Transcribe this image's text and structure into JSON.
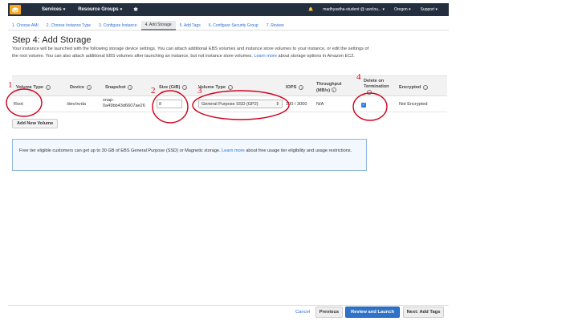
{
  "nav": {
    "services": "Services",
    "resource_groups": "Resource Groups",
    "user": "madhyastha-student @ uwclou...",
    "region": "Oregon",
    "support": "Support"
  },
  "steps": [
    "1. Choose AMI",
    "2. Choose Instance Type",
    "3. Configure Instance",
    "4. Add Storage",
    "5. Add Tags",
    "6. Configure Security Group",
    "7. Review"
  ],
  "page": {
    "title": "Step 4: Add Storage",
    "desc_1": "Your instance will be launched with the following storage device settings. You can attach additional EBS volumes and instance store volumes to your instance, or edit the settings of the root volume. You can also attach additional EBS volumes after launching an instance, but not instance store volumes. ",
    "desc_link": "Learn more",
    "desc_2": " about storage options in Amazon EC2."
  },
  "table": {
    "headers": {
      "volume_type": "Volume Type",
      "device": "Device",
      "snapshot": "Snapshot",
      "size": "Size (GiB)",
      "ebs_type": "Volume Type",
      "iops": "IOPS",
      "throughput": "Throughput (MB/s)",
      "delete": "Delete on Termination",
      "encrypted": "Encrypted"
    },
    "row": {
      "volume_type": "Root",
      "device": "/dev/xvda",
      "snapshot_1": "snap-",
      "snapshot_2": "0a49bb43d6607ae26",
      "size": "8",
      "ebs_type": "General Purpose SSD (GP2)",
      "iops": "100 / 3000",
      "throughput": "N/A",
      "delete_checked": true,
      "encrypted": "Not Encrypted"
    }
  },
  "add_volume": "Add New Volume",
  "notice": {
    "text_1": "Free tier eligible customers can get up to 30 GB of EBS General Purpose (SSD) or Magnetic storage. ",
    "link": "Learn more",
    "text_2": " about free usage tier eligibility and usage restrictions."
  },
  "footer": {
    "cancel": "Cancel",
    "previous": "Previous",
    "review": "Review and Launch",
    "next": "Next: Add Tags"
  },
  "annotations": [
    "1",
    "2",
    "3",
    "4"
  ],
  "colors": {
    "nav_bg": "#232f3e",
    "primary": "#2e73c9",
    "annotation": "#d0021b",
    "link": "#2a6dd8"
  }
}
